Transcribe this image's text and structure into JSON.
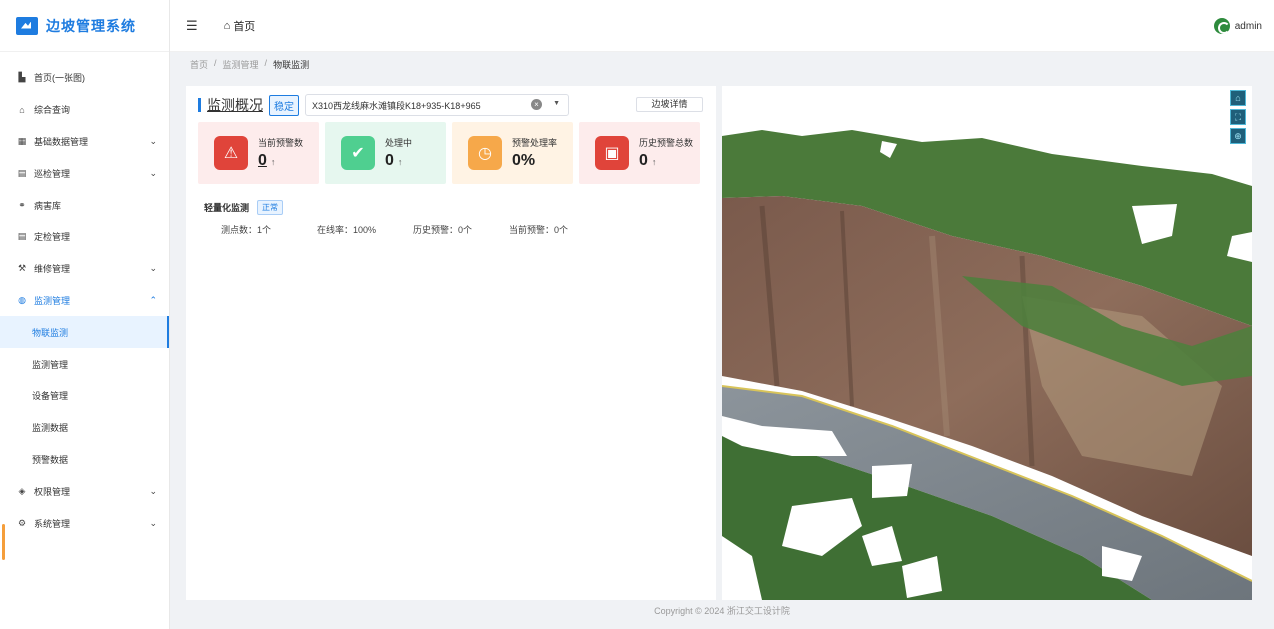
{
  "app": {
    "title": "边坡管理系统"
  },
  "header": {
    "home_tab": "首页",
    "user": "admin"
  },
  "sidebar": {
    "items": [
      {
        "label": "首页(一张图)",
        "icon": "chart-icon"
      },
      {
        "label": "综合查询",
        "icon": "home-icon"
      },
      {
        "label": "基础数据管理",
        "icon": "grid-icon"
      },
      {
        "label": "巡检管理",
        "icon": "clipboard-icon"
      },
      {
        "label": "病害库",
        "icon": "link-icon"
      },
      {
        "label": "定检管理",
        "icon": "clipboard-icon"
      },
      {
        "label": "维修管理",
        "icon": "wrench-icon"
      },
      {
        "label": "监测管理",
        "icon": "globe-icon"
      },
      {
        "label": "权限管理",
        "icon": "shield-icon"
      },
      {
        "label": "系统管理",
        "icon": "gear-icon"
      }
    ],
    "sub_items": [
      "物联监测",
      "监测管理",
      "设备管理",
      "监测数据",
      "预警数据"
    ]
  },
  "breadcrumb": [
    "首页",
    "监测管理",
    "物联监测"
  ],
  "panel": {
    "title": "监测概况",
    "status_tag": "稳定",
    "select_value": "X310西龙线麻水滩镇段K18+935-K18+965",
    "detail_button": "边坡详情",
    "stats": [
      {
        "label": "当前预警数",
        "value": "0",
        "arrow": "↑"
      },
      {
        "label": "处理中",
        "value": "0",
        "arrow": "↑"
      },
      {
        "label": "预警处理率",
        "value": "0%"
      },
      {
        "label": "历史预警总数",
        "value": "0",
        "arrow": "↑"
      }
    ],
    "light_monitor": {
      "title": "轻量化监测",
      "tag": "正常",
      "stats": [
        "测点数：1个",
        "在线率：100%",
        "历史预警：0个",
        "当前预警：0个"
      ]
    }
  },
  "map": {
    "tools": [
      "home-icon",
      "fullscreen-icon",
      "crosshair-icon"
    ]
  },
  "footer": {
    "text": "Copyright © 2024 浙江交工设计院"
  },
  "colors": {
    "accent": "#1e7ce0",
    "alert_red": "#e0443a",
    "ok_green": "#4fcf90",
    "warn_orange": "#f6a84a"
  }
}
